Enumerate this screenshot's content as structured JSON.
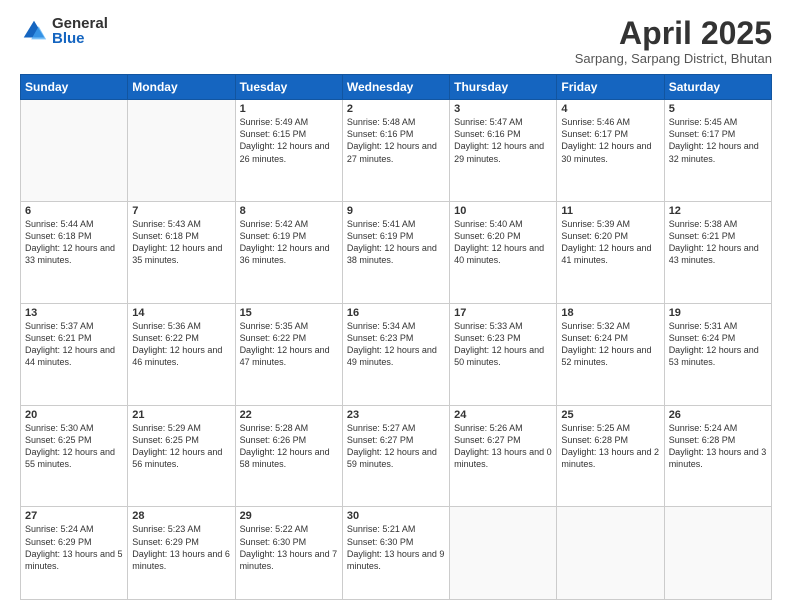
{
  "logo": {
    "general": "General",
    "blue": "Blue"
  },
  "title": "April 2025",
  "subtitle": "Sarpang, Sarpang District, Bhutan",
  "days_of_week": [
    "Sunday",
    "Monday",
    "Tuesday",
    "Wednesday",
    "Thursday",
    "Friday",
    "Saturday"
  ],
  "weeks": [
    [
      {
        "day": "",
        "info": ""
      },
      {
        "day": "",
        "info": ""
      },
      {
        "day": "1",
        "info": "Sunrise: 5:49 AM\nSunset: 6:15 PM\nDaylight: 12 hours and 26 minutes."
      },
      {
        "day": "2",
        "info": "Sunrise: 5:48 AM\nSunset: 6:16 PM\nDaylight: 12 hours and 27 minutes."
      },
      {
        "day": "3",
        "info": "Sunrise: 5:47 AM\nSunset: 6:16 PM\nDaylight: 12 hours and 29 minutes."
      },
      {
        "day": "4",
        "info": "Sunrise: 5:46 AM\nSunset: 6:17 PM\nDaylight: 12 hours and 30 minutes."
      },
      {
        "day": "5",
        "info": "Sunrise: 5:45 AM\nSunset: 6:17 PM\nDaylight: 12 hours and 32 minutes."
      }
    ],
    [
      {
        "day": "6",
        "info": "Sunrise: 5:44 AM\nSunset: 6:18 PM\nDaylight: 12 hours and 33 minutes."
      },
      {
        "day": "7",
        "info": "Sunrise: 5:43 AM\nSunset: 6:18 PM\nDaylight: 12 hours and 35 minutes."
      },
      {
        "day": "8",
        "info": "Sunrise: 5:42 AM\nSunset: 6:19 PM\nDaylight: 12 hours and 36 minutes."
      },
      {
        "day": "9",
        "info": "Sunrise: 5:41 AM\nSunset: 6:19 PM\nDaylight: 12 hours and 38 minutes."
      },
      {
        "day": "10",
        "info": "Sunrise: 5:40 AM\nSunset: 6:20 PM\nDaylight: 12 hours and 40 minutes."
      },
      {
        "day": "11",
        "info": "Sunrise: 5:39 AM\nSunset: 6:20 PM\nDaylight: 12 hours and 41 minutes."
      },
      {
        "day": "12",
        "info": "Sunrise: 5:38 AM\nSunset: 6:21 PM\nDaylight: 12 hours and 43 minutes."
      }
    ],
    [
      {
        "day": "13",
        "info": "Sunrise: 5:37 AM\nSunset: 6:21 PM\nDaylight: 12 hours and 44 minutes."
      },
      {
        "day": "14",
        "info": "Sunrise: 5:36 AM\nSunset: 6:22 PM\nDaylight: 12 hours and 46 minutes."
      },
      {
        "day": "15",
        "info": "Sunrise: 5:35 AM\nSunset: 6:22 PM\nDaylight: 12 hours and 47 minutes."
      },
      {
        "day": "16",
        "info": "Sunrise: 5:34 AM\nSunset: 6:23 PM\nDaylight: 12 hours and 49 minutes."
      },
      {
        "day": "17",
        "info": "Sunrise: 5:33 AM\nSunset: 6:23 PM\nDaylight: 12 hours and 50 minutes."
      },
      {
        "day": "18",
        "info": "Sunrise: 5:32 AM\nSunset: 6:24 PM\nDaylight: 12 hours and 52 minutes."
      },
      {
        "day": "19",
        "info": "Sunrise: 5:31 AM\nSunset: 6:24 PM\nDaylight: 12 hours and 53 minutes."
      }
    ],
    [
      {
        "day": "20",
        "info": "Sunrise: 5:30 AM\nSunset: 6:25 PM\nDaylight: 12 hours and 55 minutes."
      },
      {
        "day": "21",
        "info": "Sunrise: 5:29 AM\nSunset: 6:25 PM\nDaylight: 12 hours and 56 minutes."
      },
      {
        "day": "22",
        "info": "Sunrise: 5:28 AM\nSunset: 6:26 PM\nDaylight: 12 hours and 58 minutes."
      },
      {
        "day": "23",
        "info": "Sunrise: 5:27 AM\nSunset: 6:27 PM\nDaylight: 12 hours and 59 minutes."
      },
      {
        "day": "24",
        "info": "Sunrise: 5:26 AM\nSunset: 6:27 PM\nDaylight: 13 hours and 0 minutes."
      },
      {
        "day": "25",
        "info": "Sunrise: 5:25 AM\nSunset: 6:28 PM\nDaylight: 13 hours and 2 minutes."
      },
      {
        "day": "26",
        "info": "Sunrise: 5:24 AM\nSunset: 6:28 PM\nDaylight: 13 hours and 3 minutes."
      }
    ],
    [
      {
        "day": "27",
        "info": "Sunrise: 5:24 AM\nSunset: 6:29 PM\nDaylight: 13 hours and 5 minutes."
      },
      {
        "day": "28",
        "info": "Sunrise: 5:23 AM\nSunset: 6:29 PM\nDaylight: 13 hours and 6 minutes."
      },
      {
        "day": "29",
        "info": "Sunrise: 5:22 AM\nSunset: 6:30 PM\nDaylight: 13 hours and 7 minutes."
      },
      {
        "day": "30",
        "info": "Sunrise: 5:21 AM\nSunset: 6:30 PM\nDaylight: 13 hours and 9 minutes."
      },
      {
        "day": "",
        "info": ""
      },
      {
        "day": "",
        "info": ""
      },
      {
        "day": "",
        "info": ""
      }
    ]
  ]
}
